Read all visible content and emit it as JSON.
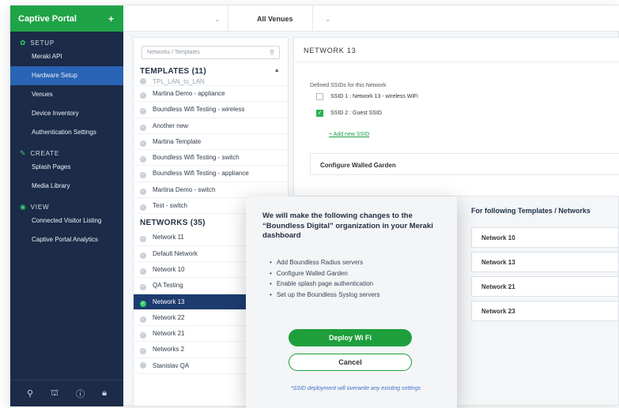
{
  "topbar": {
    "brand": "Captive Portal",
    "brand_plus": "+",
    "dropdown_arrow": "⌄",
    "venue_selector": "All Venues"
  },
  "sidebar": {
    "sections": [
      {
        "title": "SETUP",
        "icon": "gear-icon",
        "glyph": "✿",
        "items": [
          "Meraki API",
          "Hardware Setup",
          "Venues",
          "Device Inventory",
          "Authentication Settings"
        ],
        "active": "Hardware Setup"
      },
      {
        "title": "CREATE",
        "icon": "pencil-icon",
        "glyph": "✎",
        "items": [
          "Splash Pages",
          "Media Library"
        ]
      },
      {
        "title": "VIEW",
        "icon": "eye-icon",
        "glyph": "◉",
        "items": [
          "Connected Visitor Listing",
          "Captive Portal Analytics"
        ]
      }
    ],
    "footer_icons": [
      {
        "name": "wrench-icon",
        "glyph": "⚲"
      },
      {
        "name": "users-icon",
        "glyph": "⛫"
      },
      {
        "name": "help-icon",
        "glyph": "ⓘ"
      },
      {
        "name": "lock-icon",
        "glyph": "🔒︎"
      }
    ]
  },
  "middle": {
    "search_placeholder": "Networks / Templates",
    "search_icon": "⚲",
    "templates_header": "TEMPLATES (11)",
    "templates_caret": "▲",
    "templates_partial": "TPL_LAN_to_LAN",
    "templates": [
      "Martina Demo - appliance",
      "Boundless Wifi Testing - wireless",
      "Another new",
      "Martina Template",
      "Boundless Wifi Testing - switch",
      "Boundless Wifi Testing - appliance",
      "Martina Demo - switch",
      "Test - switch"
    ],
    "networks_header": "NETWORKS (35)",
    "networks": [
      "Network 11",
      "Default Network",
      "Network 10",
      "QA Testing",
      "Network 13",
      "Network 22",
      "Network 21",
      "Networks 2"
    ],
    "networks_partial": "Stanislav QA",
    "selected_network": "Network 13",
    "check_glyph": "✓"
  },
  "right": {
    "title": "NETWORK 13",
    "ssids_label": "Defined SSIDs for this Network",
    "ssids": [
      {
        "label": "SSID 1 :  Network 13 - wireless WiFi",
        "checked": false
      },
      {
        "label": "SSID 2 :  Guest SSID",
        "checked": true
      }
    ],
    "add_ssid": "+ Add new SSID",
    "walled_garden": "Configure Walled Garden"
  },
  "templates_panel": {
    "title": "For following Templates / Networks",
    "items": [
      "Network 10",
      "Network 13",
      "Network 21",
      "Network 23"
    ]
  },
  "modal": {
    "title": "We will make the following changes to the “Boundless Digital” organization in your Meraki dashboard",
    "changes": [
      "Add Boundless Radius servers",
      "Configure Walled Garden",
      "Enable splash page authentication",
      "Set up the Boundless Syslog servers"
    ],
    "deploy_label": "Deploy Wi Fi",
    "cancel_label": "Cancel",
    "note": "*SSID deployment will overwrite any existing settings"
  },
  "colors": {
    "brand_green": "#1fa347",
    "sidebar_bg": "#1b2b48",
    "sidebar_active": "#2a64b4",
    "selected_row": "#1d3b6e",
    "deploy_button": "#1e9f3c",
    "note_blue": "#3d6fc6"
  }
}
